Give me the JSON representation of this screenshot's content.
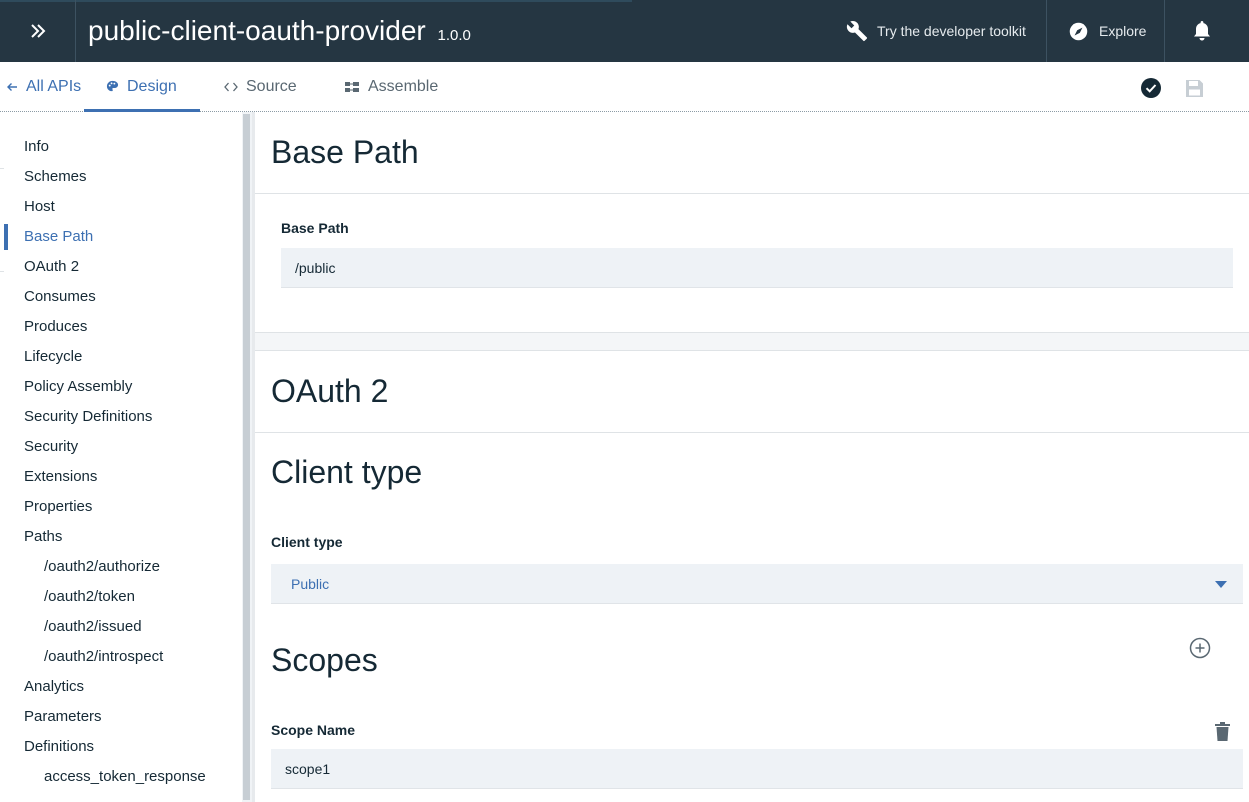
{
  "header": {
    "title": "public-client-oauth-provider",
    "version": "1.0.0",
    "toolkit_label": "Try the developer toolkit",
    "explore_label": "Explore"
  },
  "tabs": {
    "back_label": "All APIs",
    "design_label": "Design",
    "source_label": "Source",
    "assemble_label": "Assemble",
    "active": "Design"
  },
  "sidebar": {
    "items": [
      {
        "label": "Info"
      },
      {
        "label": "Schemes"
      },
      {
        "label": "Host"
      },
      {
        "label": "Base Path",
        "active": true
      },
      {
        "label": "OAuth 2"
      },
      {
        "label": "Consumes"
      },
      {
        "label": "Produces"
      },
      {
        "label": "Lifecycle"
      },
      {
        "label": "Policy Assembly"
      },
      {
        "label": "Security Definitions"
      },
      {
        "label": "Security"
      },
      {
        "label": "Extensions"
      },
      {
        "label": "Properties"
      },
      {
        "label": "Paths"
      },
      {
        "label": "/oauth2/authorize",
        "sub": true
      },
      {
        "label": "/oauth2/token",
        "sub": true
      },
      {
        "label": "/oauth2/issued",
        "sub": true
      },
      {
        "label": "/oauth2/introspect",
        "sub": true
      },
      {
        "label": "Analytics"
      },
      {
        "label": "Parameters"
      },
      {
        "label": "Definitions"
      },
      {
        "label": "access_token_response",
        "sub": true
      }
    ]
  },
  "base_path_section": {
    "heading": "Base Path",
    "field_label": "Base Path",
    "field_value": "/public"
  },
  "oauth_section": {
    "heading": "OAuth 2",
    "client_type_heading": "Client type",
    "client_type_label": "Client type",
    "client_type_value": "Public",
    "scopes_heading": "Scopes",
    "scope_name_label": "Scope Name",
    "scope_name_value": "scope1"
  },
  "colors": {
    "topbar_bg": "#253642",
    "accent": "#3d70b2",
    "field_bg": "#eef2f6"
  }
}
